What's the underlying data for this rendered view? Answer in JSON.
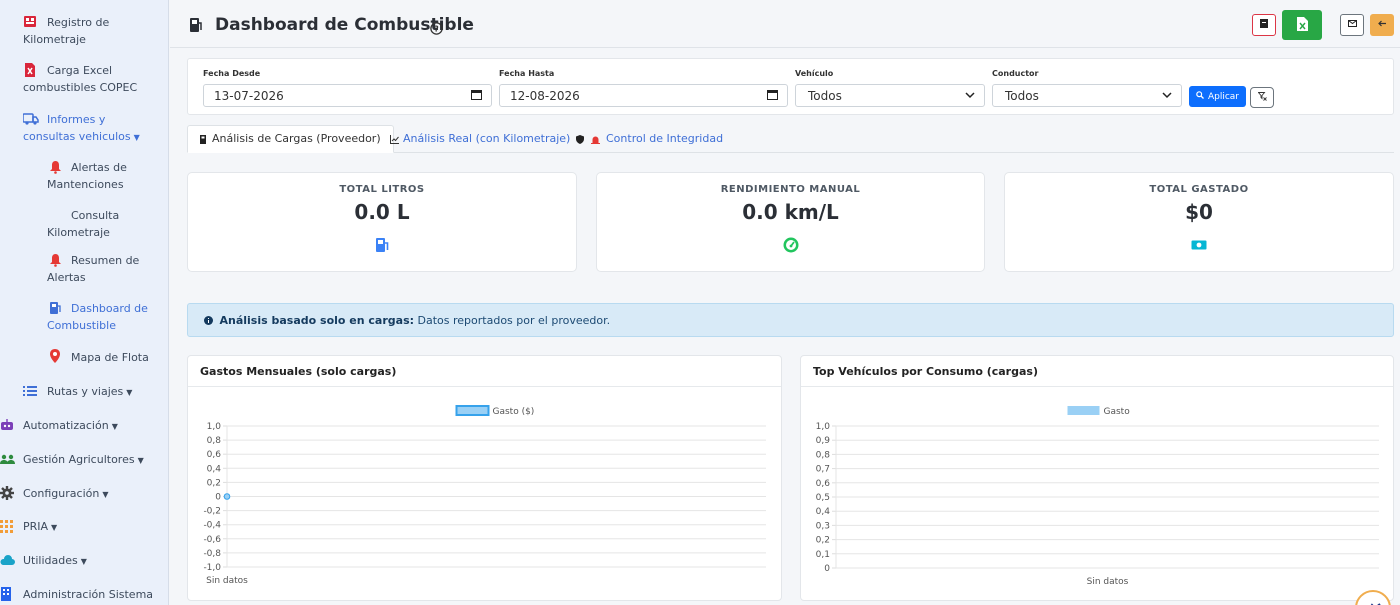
{
  "sidebar": {
    "items": [
      {
        "label": "Registro de Kilometraje",
        "icon": "clipboard-icon"
      },
      {
        "label": "Carga Excel combustibles COPEC",
        "icon": "file-excel-icon"
      },
      {
        "label": "Informes y consultas vehiculos",
        "icon": "truck-icon"
      },
      {
        "label": "Alertas de Mantenciones",
        "icon": "bell-icon"
      },
      {
        "label": "Consulta Kilometraje",
        "icon": ""
      },
      {
        "label": "Resumen de Alertas",
        "icon": "bell-icon"
      },
      {
        "label": "Dashboard de Combustible",
        "icon": "gas-pump-icon"
      },
      {
        "label": "Mapa de Flota",
        "icon": "map-pin-icon"
      },
      {
        "label": "Rutas y viajes",
        "icon": "list-icon"
      },
      {
        "label": "Automatización",
        "icon": "robot-icon"
      },
      {
        "label": "Gestión Agricultores",
        "icon": "users-icon"
      },
      {
        "label": "Configuración",
        "icon": "gear-icon"
      },
      {
        "label": "PRIA",
        "icon": "grid-icon"
      },
      {
        "label": "Utilidades",
        "icon": "cloud-icon"
      },
      {
        "label": "Administración Sistema",
        "icon": "building-icon"
      }
    ]
  },
  "header": {
    "title": "Dashboard de Combustible"
  },
  "filters": {
    "date_from_label": "Fecha Desde",
    "date_from": "13-07-2026",
    "date_to_label": "Fecha Hasta",
    "date_to": "12-08-2026",
    "vehicle_label": "Vehículo",
    "vehicle": "Todos",
    "driver_label": "Conductor",
    "driver": "Todos",
    "apply_label": "Aplicar"
  },
  "tabs": [
    {
      "label": "Análisis de Cargas (Proveedor)",
      "active": true
    },
    {
      "label": "Análisis Real (con Kilometraje)",
      "active": false
    },
    {
      "label": "Control de Integridad",
      "active": false
    }
  ],
  "stats": [
    {
      "label": "TOTAL LITROS",
      "value": "0.0 L",
      "icon": "gas-pump-icon",
      "color": "#3b82f6"
    },
    {
      "label": "RENDIMIENTO MANUAL",
      "value": "0.0 km/L",
      "icon": "gauge-icon",
      "color": "#22c55e"
    },
    {
      "label": "TOTAL GASTADO",
      "value": "$0",
      "icon": "money-bill-icon",
      "color": "#06b6d4"
    }
  ],
  "info": {
    "bold": "Análisis basado solo en cargas:",
    "text": "Datos reportados por el proveedor."
  },
  "chart_data": [
    {
      "type": "line",
      "title": "Gastos Mensuales (solo cargas)",
      "categories": [
        "Sin datos"
      ],
      "series": [
        {
          "name": "Gasto ($)",
          "values": [
            0
          ]
        }
      ],
      "ylim": [
        -1.0,
        1.0
      ],
      "yticks": [
        "1,0",
        "0,8",
        "0,6",
        "0,4",
        "0,2",
        "0",
        "-0,2",
        "-0,4",
        "-0,6",
        "-0,8",
        "-1,0"
      ],
      "legend": "top-center",
      "grid": true,
      "color": "#36a2eb"
    },
    {
      "type": "bar",
      "title": "Top Vehículos por Consumo (cargas)",
      "categories": [
        "Sin datos"
      ],
      "series": [
        {
          "name": "Gasto",
          "values": [
            0
          ]
        }
      ],
      "ylim": [
        0,
        1.0
      ],
      "yticks": [
        "1,0",
        "0,9",
        "0,8",
        "0,7",
        "0,6",
        "0,5",
        "0,4",
        "0,3",
        "0,2",
        "0,1",
        "0"
      ],
      "legend": "top-center",
      "grid": true,
      "color": "#9ad0f5"
    }
  ]
}
